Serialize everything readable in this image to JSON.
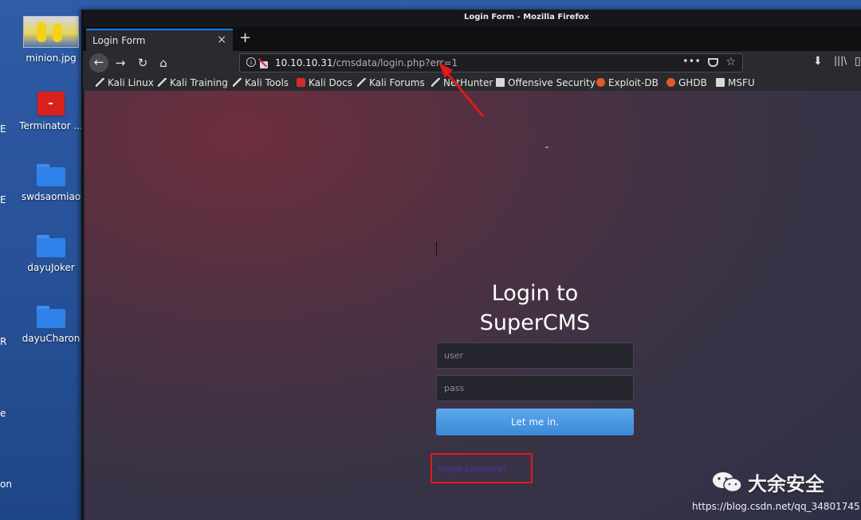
{
  "desktop": {
    "icons": [
      {
        "label": "minion.jpg"
      },
      {
        "label": "Terminator ..."
      },
      {
        "label": "swdsaomiao"
      },
      {
        "label": "dayuJoker"
      },
      {
        "label": "dayuCharon"
      }
    ],
    "edge_fragments": [
      "E",
      "E",
      "R",
      "e",
      "on"
    ]
  },
  "window": {
    "title": "Login Form - Mozilla Firefox"
  },
  "tab": {
    "title": "Login Form",
    "close": "×",
    "new_tab": "+"
  },
  "navbar": {
    "back": "←",
    "forward": "→",
    "reload": "↻",
    "home": "⌂",
    "url_host": "10.10.10.31",
    "url_path": "/cmsdata/login.php?err=1",
    "more": "•••",
    "star": "☆",
    "download": "⬇",
    "library": "|||\\",
    "sidebar": "▯"
  },
  "bookmarks": [
    {
      "label": "Kali Linux",
      "icon": "kali-icon"
    },
    {
      "label": "Kali Training",
      "icon": "kali-icon"
    },
    {
      "label": "Kali Tools",
      "icon": "kali-icon"
    },
    {
      "label": "Kali Docs",
      "icon": "pdf-icon"
    },
    {
      "label": "Kali Forums",
      "icon": "kali-icon"
    },
    {
      "label": "NetHunter",
      "icon": "kali-icon"
    },
    {
      "label": "Offensive Security",
      "icon": "offsec-icon"
    },
    {
      "label": "Exploit-DB",
      "icon": "exploit-icon"
    },
    {
      "label": "GHDB",
      "icon": "exploit-icon"
    },
    {
      "label": "MSFU",
      "icon": "offsec-icon"
    }
  ],
  "login": {
    "title_line1": "Login to",
    "title_line2": "SuperCMS",
    "user_placeholder": "user",
    "pass_placeholder": "pass",
    "button": "Let me in.",
    "forgot_link": "Forgot password?"
  },
  "watermark": {
    "brand": "大余安全",
    "url": "https://blog.csdn.net/qq_34801745"
  },
  "colors": {
    "highlight": "#e01919",
    "button": "#4a97e1",
    "link": "#5a2bb0"
  }
}
